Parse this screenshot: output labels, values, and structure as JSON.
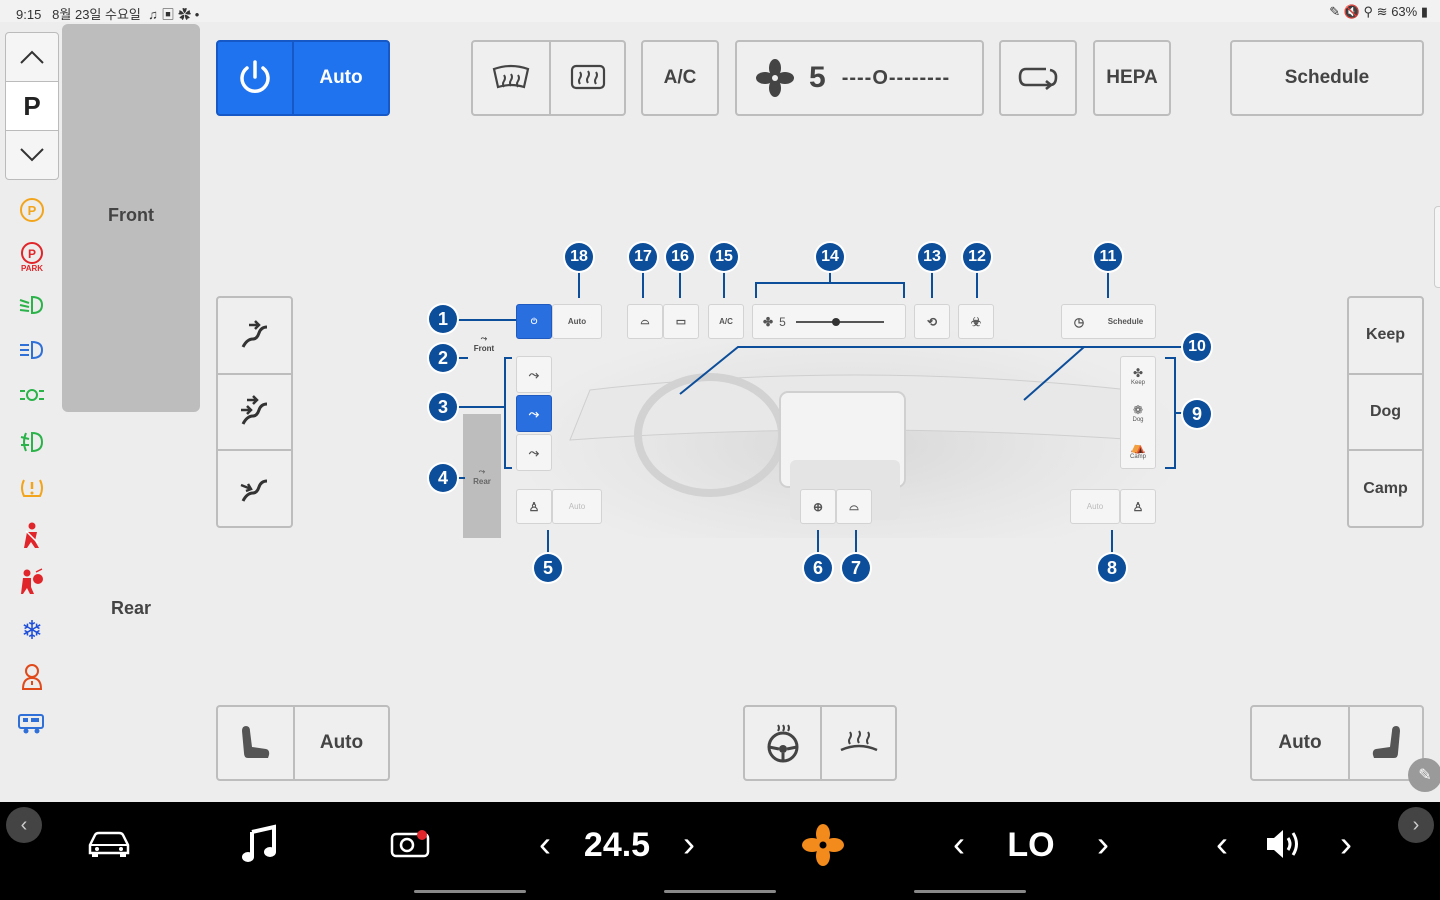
{
  "status_bar": {
    "time": "9:15",
    "date": "8월 23일 수요일",
    "battery": "63%"
  },
  "gear": {
    "up_icon": "chevron-up-icon",
    "current": "P",
    "down_icon": "chevron-down-icon"
  },
  "indicators": [
    {
      "name": "parking-brake-icon",
      "color": "#f2a51c"
    },
    {
      "name": "park-brake-red-icon",
      "label": "PARK",
      "color": "#e0262b"
    },
    {
      "name": "low-beam-icon",
      "color": "#2bb34a"
    },
    {
      "name": "high-beam-icon",
      "color": "#2f6fd8"
    },
    {
      "name": "fog-light-icon",
      "color": "#2bb34a"
    },
    {
      "name": "front-fog-icon",
      "color": "#2bb34a"
    },
    {
      "name": "tire-pressure-icon",
      "color": "#f2a51c"
    },
    {
      "name": "seatbelt-icon",
      "color": "#e0262b"
    },
    {
      "name": "airbag-icon",
      "color": "#e0262b"
    },
    {
      "name": "snowflake-icon",
      "color": "#1f4fd8"
    },
    {
      "name": "driver-alert-icon",
      "color": "#e04a1b"
    },
    {
      "name": "camper-icon",
      "color": "#2f6fd8"
    }
  ],
  "left_panel": {
    "front": "Front",
    "rear": "Rear"
  },
  "top_controls": {
    "auto": "Auto",
    "ac": "A/C",
    "fan_speed": "5",
    "fan_track": "----O--------",
    "hepa": "HEPA",
    "schedule": "Schedule"
  },
  "right_modes": {
    "keep": "Keep",
    "dog": "Dog",
    "camp": "Camp"
  },
  "bottom_controls": {
    "left_auto": "Auto",
    "right_auto": "Auto"
  },
  "diagram": {
    "auto": "Auto",
    "ac": "A/C",
    "fan": "5",
    "schedule": "Schedule",
    "front": "Front",
    "rear": "Rear",
    "keep": "Keep",
    "dog": "Dog",
    "camp": "Camp",
    "seat_auto": "Auto",
    "badges": [
      "1",
      "2",
      "3",
      "4",
      "5",
      "6",
      "7",
      "8",
      "9",
      "10",
      "11",
      "12",
      "13",
      "14",
      "15",
      "16",
      "17",
      "18"
    ]
  },
  "bottom_bar": {
    "driver_temp": "24.5",
    "passenger_temp": "LO",
    "fan_color": "#f28a1c"
  }
}
